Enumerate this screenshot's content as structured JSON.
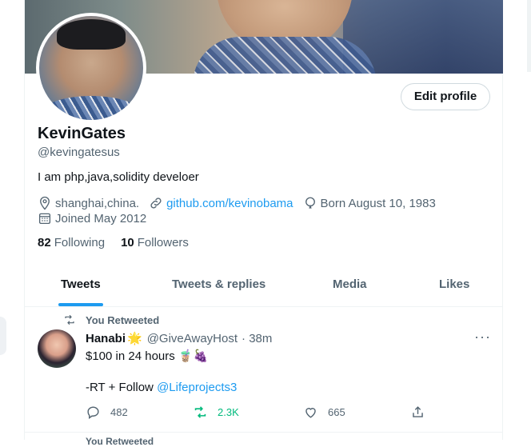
{
  "profile": {
    "name": "KevinGates",
    "handle": "@kevingatesus",
    "bio": "I am php,java,solidity develoer",
    "location": "shanghai,china.",
    "website": "github.com/kevinobama",
    "born": "Born August 10, 1983",
    "joined": "Joined May 2012",
    "following_count": "82",
    "following_label": "Following",
    "followers_count": "10",
    "followers_label": "Followers",
    "edit_label": "Edit profile"
  },
  "tabs": [
    "Tweets",
    "Tweets & replies",
    "Media",
    "Likes"
  ],
  "tweet": {
    "retweet_label": "You Retweeted",
    "author": "Hanabi",
    "author_emoji": "🌟",
    "handle": "@GiveAwayHost",
    "time": "· 38m",
    "text": "$100 in 24 hours 🧋🍇",
    "line2_prefix": "-RT + Follow ",
    "mention": "@Lifeprojects3",
    "replies": "482",
    "retweets": "2.3K",
    "likes": "665",
    "more": "···"
  },
  "next_tweet": {
    "retweet_label": "You Retweeted"
  },
  "colors": {
    "accent": "#1d9bf0",
    "retweet": "#00ba7c",
    "muted": "#536471"
  },
  "icons": [
    "location-icon",
    "link-icon",
    "balloon-icon",
    "calendar-icon",
    "retweet-icon",
    "reply-icon",
    "like-icon",
    "share-icon",
    "more-icon"
  ]
}
